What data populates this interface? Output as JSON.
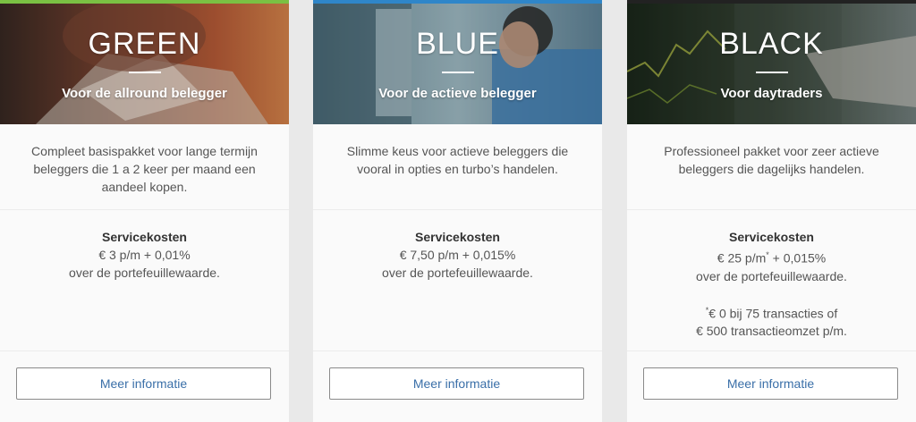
{
  "plans": [
    {
      "title": "GREEN",
      "subtitle": "Voor de allround belegger",
      "description": "Compleet basispakket voor lange termijn beleggers die 1 a 2 keer per maand een aandeel kopen.",
      "costs_label": "Servicekosten",
      "costs_value": "€ 3 p/m + 0,01%",
      "costs_basis": "over de portefeuillewaarde.",
      "button_label": "Meer informatie",
      "accent_color": "#7ac143"
    },
    {
      "title": "BLUE",
      "subtitle": "Voor de actieve belegger",
      "description": "Slimme keus voor actieve beleggers die vooral in opties en turbo’s handelen.",
      "costs_label": "Servicekosten",
      "costs_value": "€ 7,50 p/m + 0,015%",
      "costs_basis": "over de portefeuillewaarde.",
      "button_label": "Meer informatie",
      "accent_color": "#2f86c9"
    },
    {
      "title": "BLACK",
      "subtitle": "Voor daytraders",
      "description": "Professioneel pakket voor zeer actieve beleggers die dagelijks handelen.",
      "costs_label": "Servicekosten",
      "costs_value_prefix": "€ 25 p/m",
      "costs_value_marker": "*",
      "costs_value_suffix": " + 0,015%",
      "costs_basis": "over de portefeuillewaarde.",
      "note_marker": "*",
      "note_line1": "€ 0 bij 75 transacties of",
      "note_line2": "€ 500 transactieomzet p/m.",
      "button_label": "Meer informatie",
      "accent_color": "#222222"
    }
  ]
}
